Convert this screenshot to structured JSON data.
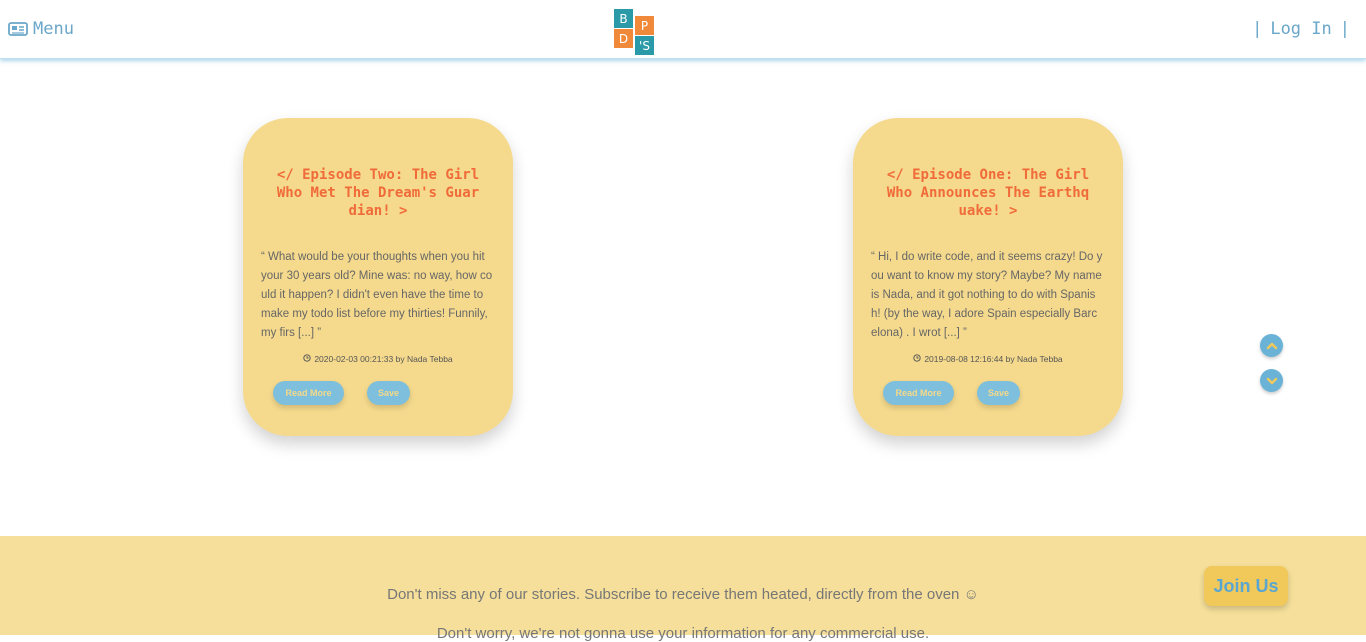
{
  "header": {
    "menu_label": "Menu",
    "menu_icon": "newspaper-icon",
    "logo_letters": [
      "B",
      "P",
      "D",
      "'S"
    ],
    "logo_colors": [
      "#2a9aa8",
      "#f08a3a",
      "#f08a3a",
      "#2a9aa8"
    ],
    "login_label": "Log In",
    "bar_left": "|",
    "bar_right": "|"
  },
  "cards": [
    {
      "title": "</ Episode Two: The Girl Who Met The Dream's Guardian! >",
      "excerpt": "“ What would be your thoughts when you hit your 30 years old? Mine was: no way, how could it happen? I didn't even have the time to make my todo list before my thirties! Funnily, my firs [...] ”",
      "meta": "2020-02-03 00:21:33 by Nada Tebba",
      "read_more": "Read More",
      "save": "Save"
    },
    {
      "title": "</ Episode One: The Girl Who Announces The Earthquake! >",
      "excerpt": "“ Hi, I do write code, and it seems crazy! Do you want to know my story? Maybe? My name is Nada, and it got nothing to do with Spanish! (by the way, I adore Spain especially Barcelona) . I wrot [...] ”",
      "meta": "2019-08-08 12:16:44 by Nada Tebba",
      "read_more": "Read More",
      "save": "Save"
    }
  ],
  "scroll": {
    "up_icon": "chevron-up-icon",
    "down_icon": "chevron-down-icon"
  },
  "footer": {
    "subscribe_text": "Don't miss any of our stories. Subscribe to receive them heated, directly from the oven ☺",
    "second_line": "Don't worry, we're not gonna use your information for any commercial use.",
    "join_label": "Join Us"
  },
  "colors": {
    "accent_blue": "#6aa7c9",
    "card_bg": "#f5da8d",
    "title_orange": "#f06b3a",
    "footer_bg": "#f5df9a"
  }
}
